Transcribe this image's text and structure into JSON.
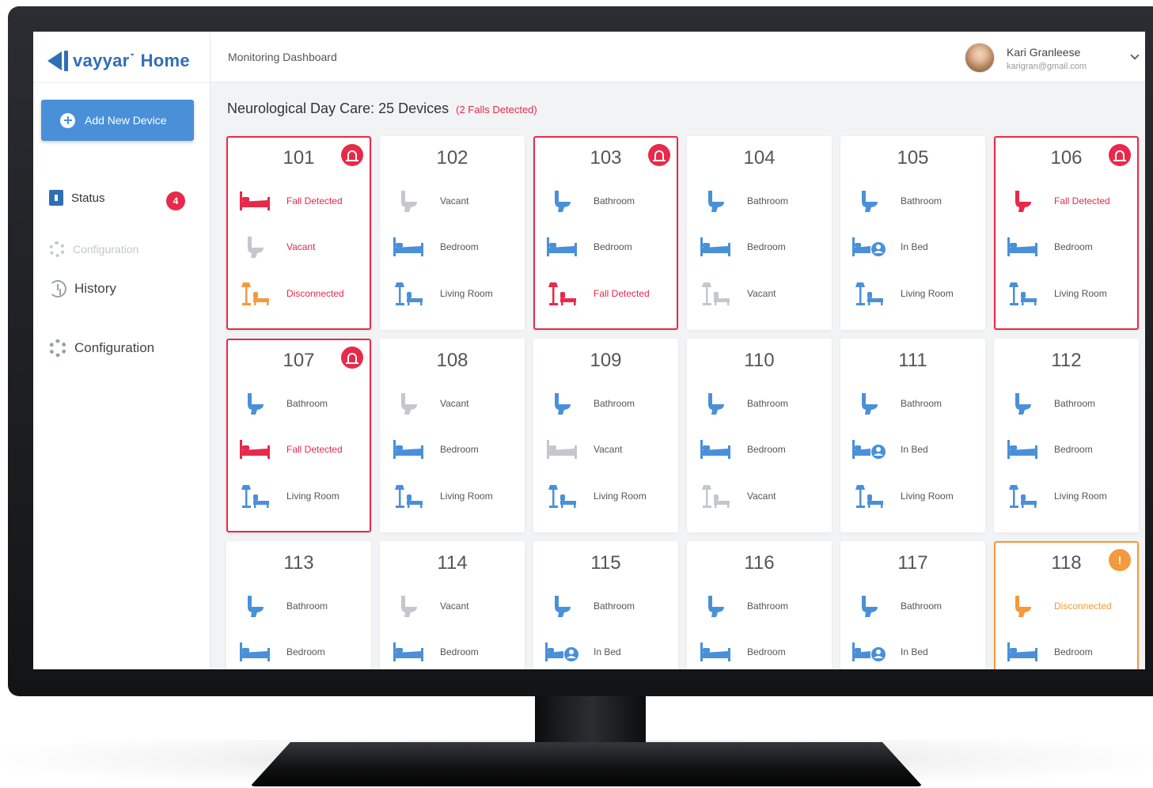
{
  "app": {
    "logo_text": "vayyar˙ Home",
    "page_title": "Monitoring Dashboard"
  },
  "colors": {
    "brand": "#2f6fb7",
    "button": "#4a90d9",
    "alert": "#e8294a",
    "warning": "#f39a3c",
    "inactive": "#c4c7cc"
  },
  "sidebar": {
    "add_label": "Add New Device",
    "status_label": "Status",
    "status_badge": "4",
    "config_faded_label": "Configuration",
    "history_label": "History",
    "config_label": "Configuration"
  },
  "user": {
    "name": "Kari Granleese",
    "email": "karigran@gmail.com"
  },
  "main": {
    "heading": "Neurological Day Care: 25 Devices",
    "falls_note": "(2 Falls Detected)"
  },
  "devices": [
    {
      "room": "101",
      "alert": "red",
      "rows": [
        {
          "icon": "bed-icon",
          "label": "Fall Detected",
          "state": "red"
        },
        {
          "icon": "toilet-icon",
          "label": "Vacant",
          "state": "red-text-gray-icon"
        },
        {
          "icon": "living-room-icon",
          "label": "Disconnected",
          "state": "orange-icon-red-text"
        }
      ]
    },
    {
      "room": "102",
      "alert": "",
      "rows": [
        {
          "icon": "toilet-icon",
          "label": "Vacant",
          "state": "inactive"
        },
        {
          "icon": "bed-icon",
          "label": "Bedroom",
          "state": "normal"
        },
        {
          "icon": "living-room-icon",
          "label": "Living Room",
          "state": "normal"
        }
      ]
    },
    {
      "room": "103",
      "alert": "red",
      "rows": [
        {
          "icon": "toilet-icon",
          "label": "Bathroom",
          "state": "normal"
        },
        {
          "icon": "bed-icon",
          "label": "Bedroom",
          "state": "normal"
        },
        {
          "icon": "living-room-icon",
          "label": "Fall Detected",
          "state": "red"
        }
      ]
    },
    {
      "room": "104",
      "alert": "",
      "rows": [
        {
          "icon": "toilet-icon",
          "label": "Bathroom",
          "state": "normal"
        },
        {
          "icon": "bed-icon",
          "label": "Bedroom",
          "state": "normal"
        },
        {
          "icon": "living-room-icon",
          "label": "Vacant",
          "state": "inactive"
        }
      ]
    },
    {
      "room": "105",
      "alert": "",
      "rows": [
        {
          "icon": "toilet-icon",
          "label": "Bathroom",
          "state": "normal"
        },
        {
          "icon": "bed-person-icon",
          "label": "In Bed",
          "state": "normal"
        },
        {
          "icon": "living-room-icon",
          "label": "Living Room",
          "state": "normal"
        }
      ]
    },
    {
      "room": "106",
      "alert": "red",
      "rows": [
        {
          "icon": "toilet-icon",
          "label": "Fall Detected",
          "state": "red"
        },
        {
          "icon": "bed-icon",
          "label": "Bedroom",
          "state": "normal"
        },
        {
          "icon": "living-room-icon",
          "label": "Living Room",
          "state": "normal"
        }
      ]
    },
    {
      "room": "107",
      "alert": "red",
      "rows": [
        {
          "icon": "toilet-icon",
          "label": "Bathroom",
          "state": "normal"
        },
        {
          "icon": "bed-icon",
          "label": "Fall Detected",
          "state": "red"
        },
        {
          "icon": "living-room-icon",
          "label": "Living Room",
          "state": "normal"
        }
      ]
    },
    {
      "room": "108",
      "alert": "",
      "rows": [
        {
          "icon": "toilet-icon",
          "label": "Vacant",
          "state": "inactive"
        },
        {
          "icon": "bed-icon",
          "label": "Bedroom",
          "state": "normal"
        },
        {
          "icon": "living-room-icon",
          "label": "Living Room",
          "state": "normal"
        }
      ]
    },
    {
      "room": "109",
      "alert": "",
      "rows": [
        {
          "icon": "toilet-icon",
          "label": "Bathroom",
          "state": "normal"
        },
        {
          "icon": "bed-icon",
          "label": "Vacant",
          "state": "inactive"
        },
        {
          "icon": "living-room-icon",
          "label": "Living Room",
          "state": "normal"
        }
      ]
    },
    {
      "room": "110",
      "alert": "",
      "rows": [
        {
          "icon": "toilet-icon",
          "label": "Bathroom",
          "state": "normal"
        },
        {
          "icon": "bed-icon",
          "label": "Bedroom",
          "state": "normal"
        },
        {
          "icon": "living-room-icon",
          "label": "Vacant",
          "state": "inactive"
        }
      ]
    },
    {
      "room": "111",
      "alert": "",
      "rows": [
        {
          "icon": "toilet-icon",
          "label": "Bathroom",
          "state": "normal"
        },
        {
          "icon": "bed-person-icon",
          "label": "In Bed",
          "state": "normal"
        },
        {
          "icon": "living-room-icon",
          "label": "Living Room",
          "state": "normal"
        }
      ]
    },
    {
      "room": "112",
      "alert": "",
      "rows": [
        {
          "icon": "toilet-icon",
          "label": "Bathroom",
          "state": "normal"
        },
        {
          "icon": "bed-icon",
          "label": "Bedroom",
          "state": "normal"
        },
        {
          "icon": "living-room-icon",
          "label": "Living Room",
          "state": "normal"
        }
      ]
    },
    {
      "room": "113",
      "alert": "",
      "rows": [
        {
          "icon": "toilet-icon",
          "label": "Bathroom",
          "state": "normal"
        },
        {
          "icon": "bed-icon",
          "label": "Bedroom",
          "state": "normal"
        }
      ]
    },
    {
      "room": "114",
      "alert": "",
      "rows": [
        {
          "icon": "toilet-icon",
          "label": "Vacant",
          "state": "inactive"
        },
        {
          "icon": "bed-icon",
          "label": "Bedroom",
          "state": "normal"
        }
      ]
    },
    {
      "room": "115",
      "alert": "",
      "rows": [
        {
          "icon": "toilet-icon",
          "label": "Bathroom",
          "state": "normal"
        },
        {
          "icon": "bed-person-icon",
          "label": "In Bed",
          "state": "normal"
        }
      ]
    },
    {
      "room": "116",
      "alert": "",
      "rows": [
        {
          "icon": "toilet-icon",
          "label": "Bathroom",
          "state": "normal"
        },
        {
          "icon": "bed-icon",
          "label": "Bedroom",
          "state": "normal"
        }
      ]
    },
    {
      "room": "117",
      "alert": "",
      "rows": [
        {
          "icon": "toilet-icon",
          "label": "Bathroom",
          "state": "normal"
        },
        {
          "icon": "bed-person-icon",
          "label": "In Bed",
          "state": "normal"
        }
      ]
    },
    {
      "room": "118",
      "alert": "orange",
      "badge": "!",
      "rows": [
        {
          "icon": "toilet-icon",
          "label": "Disconnected",
          "state": "orange"
        },
        {
          "icon": "bed-icon",
          "label": "Bedroom",
          "state": "normal"
        }
      ]
    }
  ]
}
